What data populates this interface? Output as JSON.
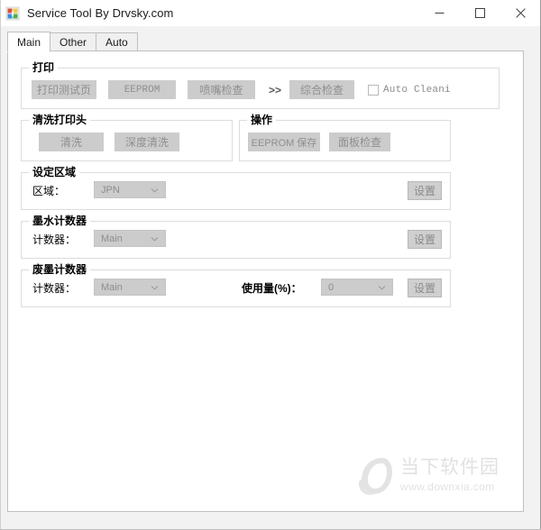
{
  "window": {
    "title": "Service Tool By Drvsky.com",
    "icon": "app-icon",
    "controls": {
      "minimize": "—",
      "maximize": "☐",
      "close": "✕"
    }
  },
  "tabs": [
    {
      "label": "Main",
      "active": true
    },
    {
      "label": "Other",
      "active": false
    },
    {
      "label": "Auto",
      "active": false
    }
  ],
  "groups": {
    "print": {
      "legend": "打印",
      "buttons": [
        {
          "label": "打印测试页"
        },
        {
          "label": "EEPROM"
        },
        {
          "label": "喷嘴检查"
        },
        {
          "label": "综合检查"
        }
      ],
      "separator": ">>",
      "checkbox": {
        "label": "Auto Cleani:",
        "checked": false
      }
    },
    "cleaning": {
      "legend": "清洗打印头",
      "buttons": [
        {
          "label": "清洗"
        },
        {
          "label": "深度清洗"
        }
      ]
    },
    "operation": {
      "legend": "操作",
      "buttons": [
        {
          "label": "EEPROM 保存"
        },
        {
          "label": "面板检查"
        }
      ]
    },
    "region": {
      "legend": "设定区域",
      "field_label": "区域：",
      "value": "JPN",
      "set_button": "设置"
    },
    "ink_counter": {
      "legend": "墨水计数器",
      "field_label": "计数器：",
      "value": "Main",
      "set_button": "设置"
    },
    "waste_ink_counter": {
      "legend": "废墨计数器",
      "field_label": "计数器：",
      "value": "Main",
      "usage_label": "使用量(%)：",
      "usage_value": "0",
      "set_button": "设置"
    }
  },
  "watermark": {
    "cn": "当下软件园",
    "url": "www.downxia.com"
  },
  "colors": {
    "titlebar_bg": "#ffffff",
    "client_bg": "#f2f2f2",
    "page_bg": "#ffffff",
    "button_disabled_bg": "#cccccc",
    "button_disabled_text": "#8e8e8e",
    "group_border": "#dcdcdc",
    "watermark": "#c9c9c9"
  }
}
